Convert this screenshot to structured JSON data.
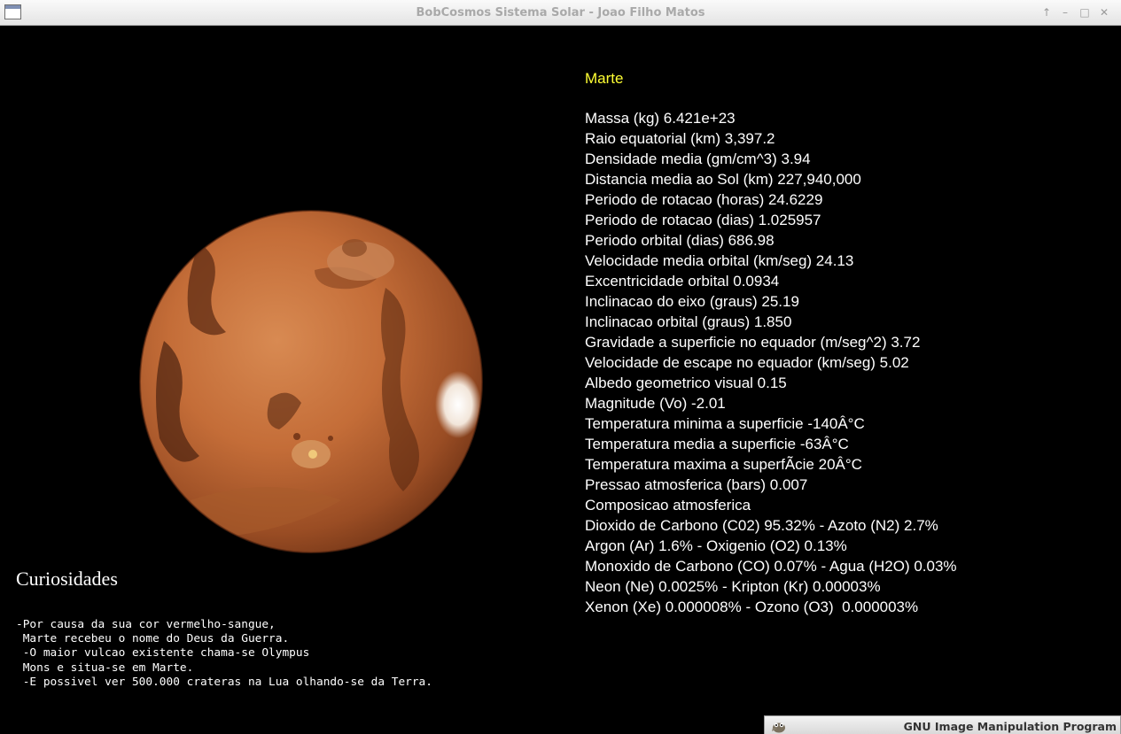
{
  "window": {
    "title": "BobCosmos Sistema Solar - Joao Filho Matos",
    "buttons": {
      "pin": "↑",
      "minimize": "–",
      "maximize": "□",
      "close": "✕"
    }
  },
  "planet": {
    "name": "Marte",
    "name_color": "#ffff33",
    "properties": [
      "Massa (kg) 6.421e+23",
      "Raio equatorial (km) 3,397.2",
      "Densidade media (gm/cm^3) 3.94",
      "Distancia media ao Sol (km) 227,940,000",
      "Periodo de rotacao (horas) 24.6229",
      "Periodo de rotacao (dias) 1.025957",
      "Periodo orbital (dias) 686.98",
      "Velocidade media orbital (km/seg) 24.13",
      "Excentricidade orbital 0.0934",
      "Inclinacao do eixo (graus) 25.19",
      "Inclinacao orbital (graus) 1.850",
      "Gravidade a superficie no equador (m/seg^2) 3.72",
      "Velocidade de escape no equador (km/seg) 5.02",
      "Albedo geometrico visual 0.15",
      "Magnitude (Vo) -2.01",
      "Temperatura minima a superficie -140Â°C",
      "Temperatura media a superficie -63Â°C",
      "Temperatura maxima a superfÃ­cie 20Â°C",
      "Pressao atmosferica (bars) 0.007",
      "Composicao atmosferica",
      "Dioxido de Carbono (C02) 95.32% - Azoto (N2) 2.7%",
      "Argon (Ar) 1.6% - Oxigenio (O2) 0.13%",
      "Monoxido de Carbono (CO) 0.07% - Agua (H2O) 0.03%",
      "Neon (Ne) 0.0025% - Kripton (Kr) 0.00003%",
      "Xenon (Xe) 0.000008% - Ozono (O3)  0.000003%"
    ]
  },
  "curiosities": {
    "title": "Curiosidades",
    "text": "-Por causa da sua cor vermelho-sangue,\n Marte recebeu o nome do Deus da Guerra.\n -O maior vulcao existente chama-se Olympus\n Mons e situa-se em Marte.\n -E possivel ver 500.000 crateras na Lua olhando-se da Terra."
  },
  "taskbar": {
    "label": "GNU Image Manipulation Program",
    "icon": "gimp-icon"
  }
}
